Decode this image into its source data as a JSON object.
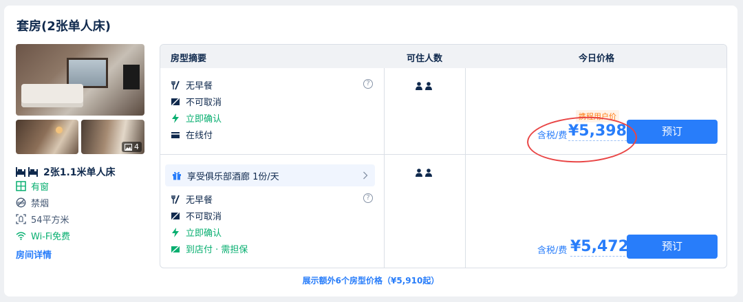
{
  "room": {
    "title": "套房(2张单人床)",
    "photo_count": "4",
    "bed": "2张1.1米单人床",
    "features": [
      {
        "icon": "window-icon",
        "label": "有窗",
        "color": "#06ae6f"
      },
      {
        "icon": "no-smoking-icon",
        "label": "禁烟",
        "color": "#455873"
      },
      {
        "icon": "area-icon",
        "label": "54平方米",
        "color": "#455873"
      },
      {
        "icon": "wifi-icon",
        "label": "Wi-Fi免费",
        "color": "#06ae6f"
      }
    ],
    "detail_link": "房间详情"
  },
  "table": {
    "headers": [
      "房型摘要",
      "可住人数",
      "今日价格"
    ],
    "rows": [
      {
        "items": [
          {
            "icon": "fork-knife-icon",
            "label": "无早餐"
          },
          {
            "icon": "no-cancel-icon",
            "label": "不可取消"
          },
          {
            "icon": "lightning-icon",
            "label": "立即确认"
          },
          {
            "icon": "card-icon",
            "label": "在线付"
          }
        ],
        "help": "?",
        "occupancy": 2,
        "promo": "携程用户价",
        "tax_label": "含税/费",
        "price": "¥5,398",
        "book": "预订"
      },
      {
        "club": "享受俱乐部酒廊 1份/天",
        "items": [
          {
            "icon": "fork-knife-icon",
            "label": "无早餐"
          },
          {
            "icon": "no-cancel-icon",
            "label": "不可取消"
          },
          {
            "icon": "lightning-icon",
            "label": "立即确认"
          },
          {
            "icon": "pay-at-hotel-icon",
            "label": "到店付 · 需担保"
          }
        ],
        "help": "?",
        "occupancy": 2,
        "tax_label": "含税/费",
        "price": "¥5,472",
        "book": "预订"
      }
    ]
  },
  "more_link": "展示额外6个房型价格（¥5,910起）",
  "colors": {
    "accent": "#287dfa",
    "green": "#06ae6f",
    "annotation": "#e94545",
    "promo": "#ff7d13"
  }
}
